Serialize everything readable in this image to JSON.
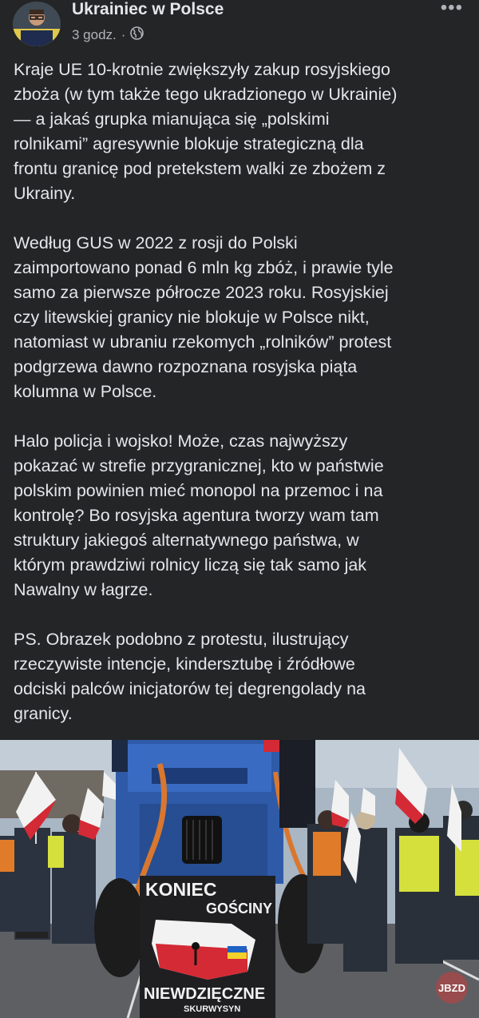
{
  "post": {
    "author": "Ukrainiec w Polsce",
    "time": "3 godz.",
    "separator": "·",
    "more_label": "•••",
    "paragraphs": [
      "Kraje UE 10-krotnie zwiększyły zakup rosyjskiego\nzboża (w tym także tego ukradzionego w Ukrainie)\n— a jakaś grupka mianująca się „polskimi\nrolnikami” agresywnie blokuje strategiczną dla\nfrontu granicę pod pretekstem walki ze zbożem z\nUkrainy.",
      "Według GUS w 2022 z rosji do Polski\nzaimportowano ponad 6 mln kg zbóż, i prawie tyle\nsamo za pierwsze półrocze 2023 roku. Rosyjskiej\nczy litewskiej granicy nie blokuje w Polsce nikt,\nnatomiast w ubraniu rzekomych „rolników” protest\npodgrzewa dawno rozpoznana rosyjska piąta\nkolumna w Polsce.",
      "Halo policja i wojsko! Może, czas najwyższy\npokazać w strefie przygranicznej, kto w państwie\npolskim powinien mieć monopol na przemoc i na\nkontrolę? Bo rosyjska agentura tworzy wam tam\nstruktury jakiegoś alternatywnego państwa, w\nktórym prawdziwi rolnicy liczą się tak samo jak\nNawalny w łagrze.",
      "PS. Obrazek podobno z protestu, ilustrujący\nrzeczywiste intencje, kindersztubę i źródłowe\nodciski palców inicjatorów tej degrengolady na\ngranicy."
    ]
  },
  "photo": {
    "banner_top": "KONIEC",
    "banner_top2": "GOŚCINY",
    "banner_bottom": "NIEWDZIĘCZNE",
    "banner_bottom2": "SKURWYSYN",
    "watermark": "JBZD",
    "icons": [
      "globe-icon"
    ]
  },
  "colors": {
    "background": "#242526",
    "text": "#e4e6eb",
    "secondary": "#b0b3b8",
    "tractor": "#2f5aa8",
    "flag_red": "#d42a35"
  }
}
